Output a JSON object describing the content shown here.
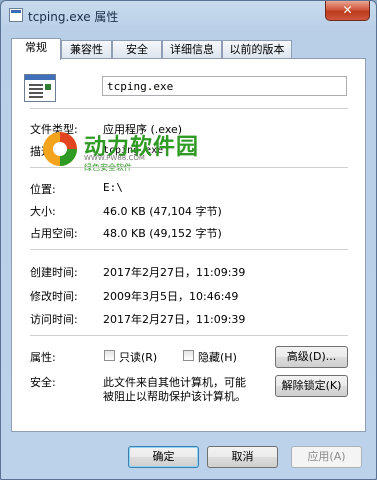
{
  "window": {
    "title": "tcping.exe 属性",
    "close_glyph": "✕"
  },
  "tabs": [
    {
      "label": "常规"
    },
    {
      "label": "兼容性"
    },
    {
      "label": "安全"
    },
    {
      "label": "详细信息"
    },
    {
      "label": "以前的版本"
    }
  ],
  "general": {
    "file_name": "tcping.exe",
    "file_type_label": "文件类型:",
    "file_type_value": "应用程序 (.exe)",
    "description_label": "描述:",
    "description_value": "tcping.exe",
    "location_label": "位置:",
    "location_value": "E:\\",
    "size_label": "大小:",
    "size_value": "46.0 KB (47,104 字节)",
    "size_on_disk_label": "占用空间:",
    "size_on_disk_value": "48.0 KB (49,152 字节)",
    "created_label": "创建时间:",
    "created_value": "2017年2月27日，11:09:39",
    "modified_label": "修改时间:",
    "modified_value": "2009年3月5日，10:46:49",
    "accessed_label": "访问时间:",
    "accessed_value": "2017年2月27日，11:09:39",
    "attributes_label": "属性:",
    "readonly_label": "只读(R)",
    "hidden_label": "隐藏(H)",
    "advanced_button": "高级(D)...",
    "security_label": "安全:",
    "security_text_1": "此文件来自其他计算机，可能",
    "security_text_2": "被阻止以帮助保护该计算机。",
    "unblock_button": "解除锁定(K)"
  },
  "watermark": {
    "title": "动力软件园",
    "url": "WWW.PW88.COM",
    "subtitle": "绿色安全软件"
  },
  "footer": {
    "ok": "确定",
    "cancel": "取消",
    "apply": "应用(A)"
  }
}
